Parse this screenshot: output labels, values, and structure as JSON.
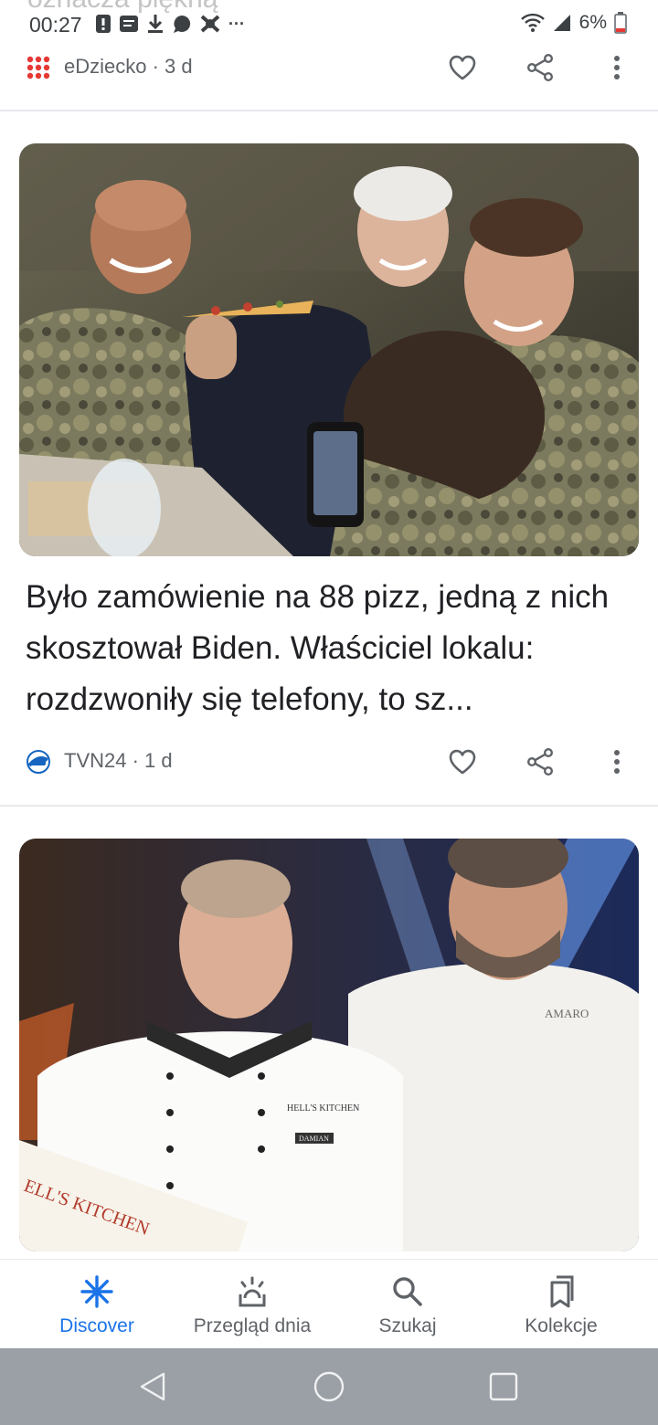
{
  "status_bar": {
    "time": "00:27",
    "battery": "6%",
    "peek_title": "oznacza piękną",
    "overflow": "···",
    "colors": {
      "battery_low": "#e53935"
    },
    "icons": [
      "alert-icon",
      "notes-icon",
      "download-icon",
      "messenger-icon",
      "app-icon",
      "overflow-dots",
      "wifi-icon",
      "signal-icon",
      "battery-icon"
    ]
  },
  "top_meta": {
    "source": "eDziecko · 3 d",
    "logo_colors": [
      "#e53935",
      "#e53935",
      "#e53935",
      "#e53935",
      "#e53935",
      "#e53935",
      "#e53935",
      "#e53935",
      "#e53935"
    ],
    "icons": [
      "heart-icon",
      "share-icon",
      "more-vert-icon"
    ]
  },
  "card1": {
    "image_description_icon": "photo-biden-soldiers-pizza",
    "headline": "Było zamówienie na 88 pizz, jedną z nich skosztował Biden. Właściciel lokalu: rozdzwoniły się telefony, to sz...",
    "source": "TVN24 · 1 d",
    "logo_color": "#1565c0"
  },
  "card2": {
    "image_description_icon": "photo-hells-kitchen-chefs"
  },
  "bottom_nav": {
    "items": [
      {
        "label": "Discover",
        "icon": "discover-asterisk-icon"
      },
      {
        "label": "Przegląd dnia",
        "icon": "daily-sunrise-icon"
      },
      {
        "label": "Szukaj",
        "icon": "search-icon"
      },
      {
        "label": "Kolekcje",
        "icon": "collections-icon"
      }
    ],
    "active_color": "#1a73e8"
  },
  "system_nav": {
    "icons": [
      "back-triangle-icon",
      "home-circle-icon",
      "recents-square-icon"
    ]
  }
}
